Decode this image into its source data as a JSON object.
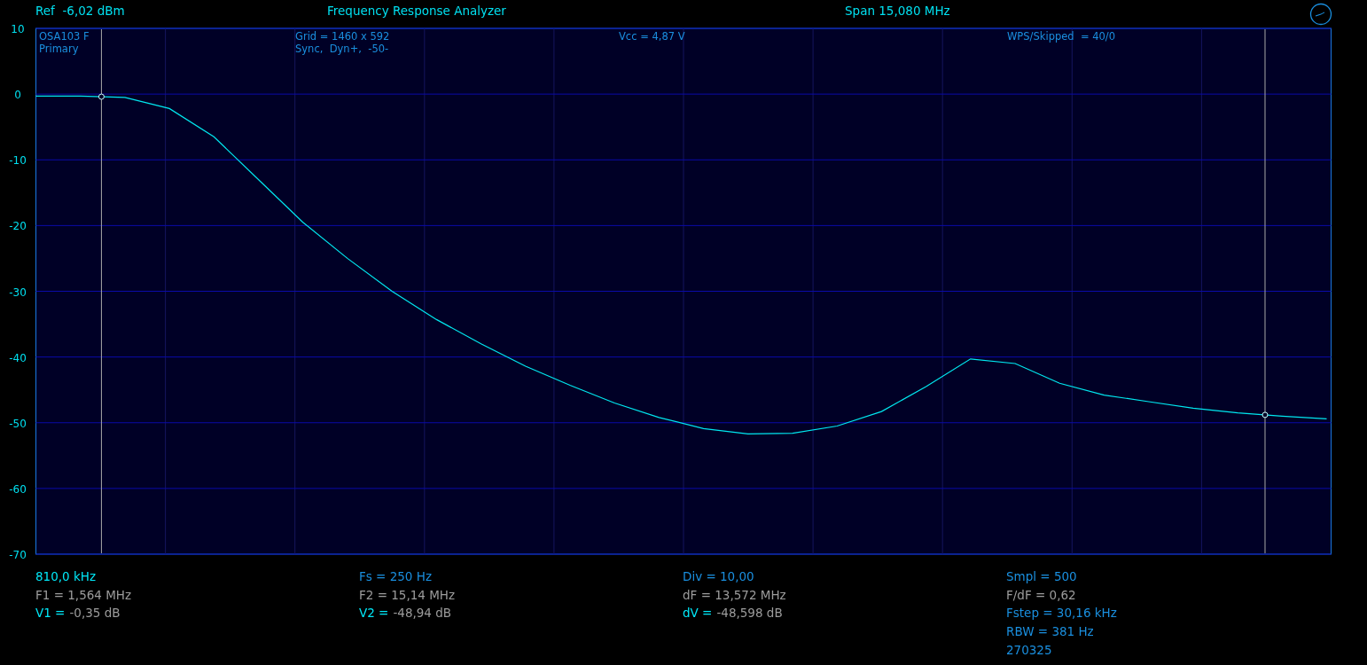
{
  "header": {
    "ref": "Ref  -6,02 dBm",
    "title": "Frequency Response Analyzer",
    "span": "Span 15,080 MHz"
  },
  "overlay": [
    {
      "lines": [
        "OSA103 F",
        "Primary"
      ]
    },
    {
      "lines": [
        "Grid = 1460 x 592",
        "Sync,  Dyn+,  -50-"
      ]
    },
    {
      "lines": [
        "Vcc = 4,87 V"
      ]
    },
    {
      "lines": [
        "WPS/Skipped  = 40/0"
      ]
    }
  ],
  "chart_data": {
    "type": "line",
    "grid": true,
    "ylim": [
      -70,
      10
    ],
    "yticks": [
      10,
      0,
      -10,
      -20,
      -30,
      -40,
      -50,
      -60,
      -70
    ],
    "categories": [
      null,
      null,
      null,
      null,
      null,
      null,
      null,
      null,
      null,
      null,
      null,
      null,
      null,
      null,
      null,
      null,
      null,
      null,
      null,
      null,
      null,
      null,
      null,
      null,
      null,
      null,
      null,
      null,
      null,
      null
    ],
    "series": [
      {
        "color": "#00e8f0",
        "values": [
          -0.3,
          -0.3,
          -0.5,
          -2.2,
          -6.5,
          -13,
          -19.5,
          -25,
          -30,
          -34.3,
          -38,
          -41.4,
          -44.3,
          -47,
          -49.2,
          -50.9,
          -51.7,
          -51.6,
          -50.5,
          -48.3,
          -44.5,
          -40.3,
          -41,
          -44,
          -45.8,
          -46.8,
          -47.8,
          -48.5,
          -49,
          -49.4
        ]
      }
    ]
  },
  "readouts": [
    [
      {
        "kind": "accent",
        "text": "810,0 kHz"
      },
      {
        "kind": "muted",
        "text": "F1 = 1,564 MHz"
      },
      {
        "kind": "pair",
        "label": "V1 =",
        "value": "-0,35 dB"
      }
    ],
    [
      {
        "kind": "info",
        "text": "Fs = 250 Hz"
      },
      {
        "kind": "muted",
        "text": "F2 = 15,14 MHz"
      },
      {
        "kind": "pair",
        "label": "V2 =",
        "value": "-48,94 dB"
      }
    ],
    [
      {
        "kind": "info",
        "text": "Div = 10,00"
      },
      {
        "kind": "muted",
        "text": "dF = 13,572 MHz"
      },
      {
        "kind": "pair",
        "label": "dV =",
        "value": "-48,598 dB"
      }
    ],
    [
      {
        "kind": "info",
        "text": "Smpl = 500"
      },
      {
        "kind": "muted",
        "text": "F/dF = 0,62"
      },
      {
        "kind": "info",
        "text": "Fstep = 30,16 kHz"
      },
      {
        "kind": "info",
        "text": "RBW = 381 Hz"
      },
      {
        "kind": "info",
        "text": "270325"
      }
    ]
  ]
}
